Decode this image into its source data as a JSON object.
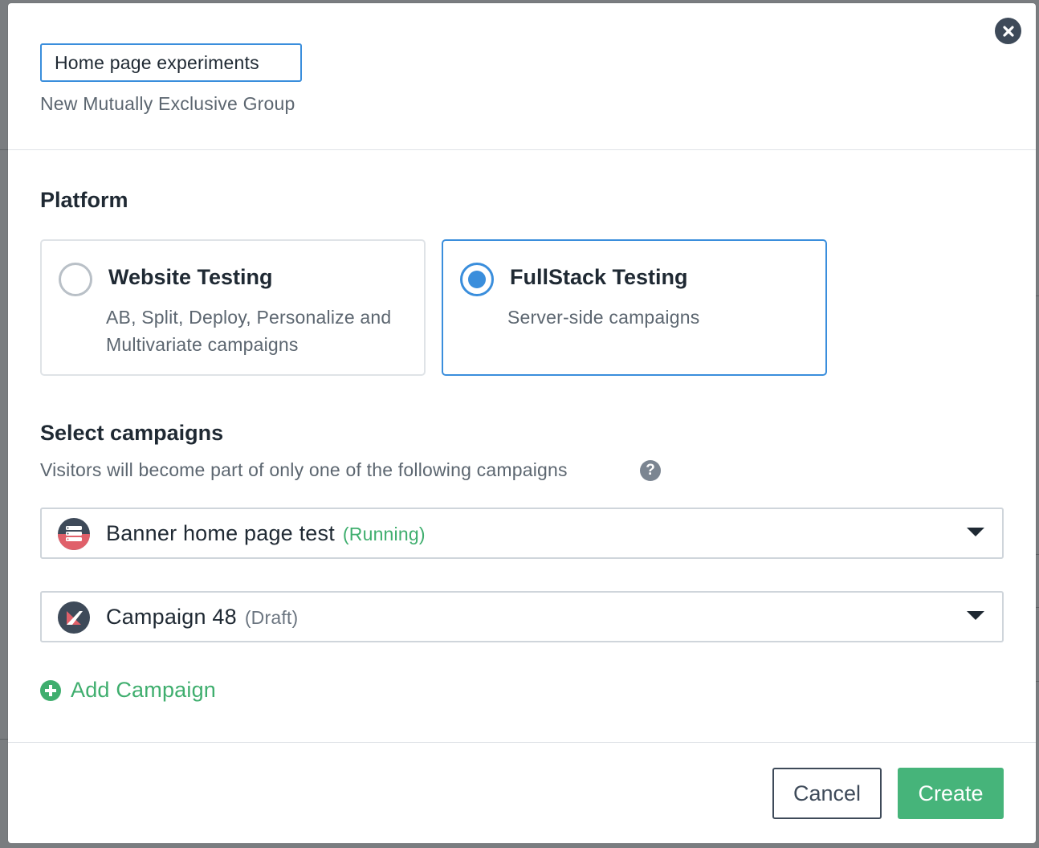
{
  "group": {
    "name_value": "Home page experiments",
    "subtitle": "New Mutually Exclusive Group"
  },
  "platform": {
    "heading": "Platform",
    "options": [
      {
        "title": "Website Testing",
        "description": "AB, Split, Deploy, Personalize and Multivariate campaigns",
        "selected": false
      },
      {
        "title": "FullStack Testing",
        "description": "Server-side campaigns",
        "selected": true
      }
    ]
  },
  "campaigns": {
    "heading": "Select campaigns",
    "helper": "Visitors will become part of only one of the following campaigns",
    "help_glyph": "?",
    "items": [
      {
        "name": "Banner home page test",
        "status": "(Running)",
        "status_color": "#3fae6e",
        "icon": "stack-icon"
      },
      {
        "name": "Campaign 48",
        "status": "(Draft)",
        "status_color": "#6b7580",
        "icon": "fullstack-logo-icon"
      }
    ],
    "add_label": "Add Campaign"
  },
  "footer": {
    "cancel_label": "Cancel",
    "create_label": "Create"
  },
  "colors": {
    "accent_blue": "#3a8edc",
    "success_green": "#46b47a",
    "text_dark": "#1f2933",
    "text_muted": "#5c6670"
  },
  "icons": {
    "close": "close-circle-icon",
    "help": "question-circle-icon",
    "add": "plus-circle-icon",
    "dropdown": "caret-down-icon"
  }
}
